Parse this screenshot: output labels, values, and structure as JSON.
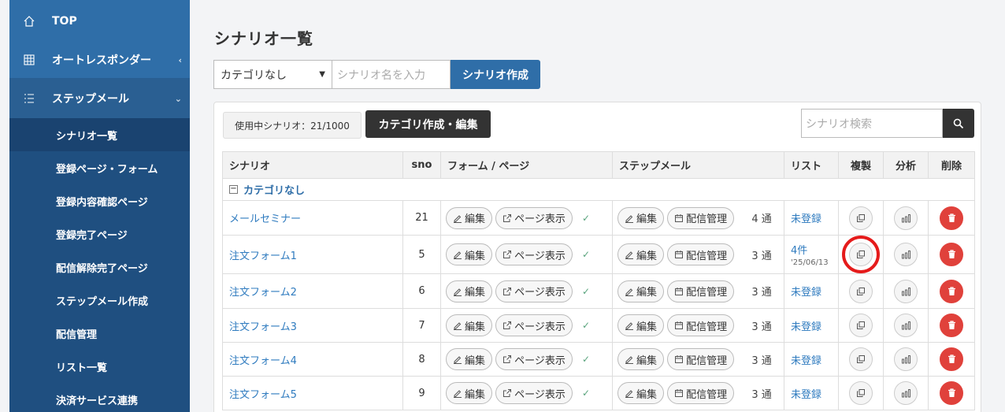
{
  "sidebar": {
    "top": "TOP",
    "autoresponder": "オートレスポンダー",
    "stepmail": "ステップメール",
    "sub": [
      "シナリオ一覧",
      "登録ページ・フォーム",
      "登録内容確認ページ",
      "登録完了ページ",
      "配信解除完了ページ",
      "ステップメール作成",
      "配信管理",
      "リスト一覧",
      "決済サービス連携"
    ]
  },
  "header": {
    "title": "シナリオ一覧",
    "category_select": "カテゴリなし",
    "name_placeholder": "シナリオ名を入力",
    "create_label": "シナリオ作成"
  },
  "panel": {
    "usage": "使用中シナリオ：21/1000",
    "category_edit": "カテゴリ作成・編集",
    "search_placeholder": "シナリオ検索"
  },
  "table": {
    "headers": [
      "シナリオ",
      "sno",
      "フォーム / ページ",
      "ステップメール",
      "リスト",
      "複製",
      "分析",
      "削除"
    ],
    "category": "カテゴリなし",
    "edit_label": "編集",
    "page_label": "ページ表示",
    "manage_label": "配信管理",
    "rows": [
      {
        "name": "メールセミナー",
        "sno": "21",
        "count": "4 通",
        "list": "未登録",
        "date": ""
      },
      {
        "name": "注文フォーム1",
        "sno": "5",
        "count": "3 通",
        "list": "4件",
        "date": "'25/06/13"
      },
      {
        "name": "注文フォーム2",
        "sno": "6",
        "count": "3 通",
        "list": "未登録",
        "date": ""
      },
      {
        "name": "注文フォーム3",
        "sno": "7",
        "count": "3 通",
        "list": "未登録",
        "date": ""
      },
      {
        "name": "注文フォーム4",
        "sno": "8",
        "count": "3 通",
        "list": "未登録",
        "date": ""
      },
      {
        "name": "注文フォーム5",
        "sno": "9",
        "count": "3 通",
        "list": "未登録",
        "date": ""
      }
    ]
  },
  "colors": {
    "sidebar": "#1f4f80",
    "accent": "#2f6ea8",
    "delete": "#e0413b",
    "highlight": "#e51b1b"
  }
}
